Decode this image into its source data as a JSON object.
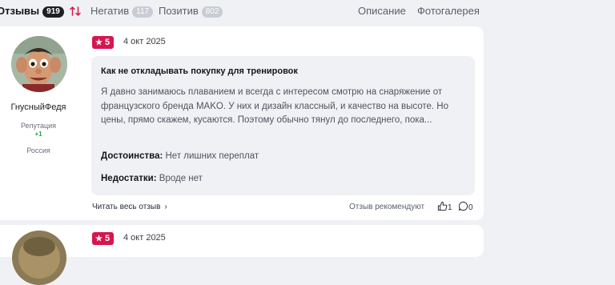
{
  "tabs": {
    "reviews": {
      "label": "Отзывы",
      "count": "919"
    },
    "negative": {
      "label": "Негатив",
      "count": "117"
    },
    "positive": {
      "label": "Позитив",
      "count": "802"
    },
    "description": "Описание",
    "gallery": "Фотогалерея",
    "sort_icon": "sort-arrows-icon"
  },
  "colors": {
    "accent": "#d6164f",
    "page_bg": "#f0f1f4",
    "card_bg": "#ffffff",
    "positive_rep": "#2aa24b"
  },
  "reviews": [
    {
      "user": {
        "name": "ГнусныйФедя",
        "reputation_label": "Репутация",
        "reputation_value": "+1",
        "country": "Россия"
      },
      "rating": "5",
      "date": "4 окт 2025",
      "title": "Как не откладывать покупку для тренировок",
      "text": "Я давно занимаюсь плаванием и всегда с интересом смотрю на снаряжение от французского бренда MAKO. У них и дизайн классный, и качество на высоте. Но цены, прямо скажем, кусаются. Поэтому обычно тянул до последнего, пока...",
      "pros_label": "Достоинства:",
      "pros": "Нет лишних переплат",
      "cons_label": "Недостатки:",
      "cons": "Вроде нет",
      "read_more": "Читать весь отзыв",
      "recommends": "Отзыв рекомендуют",
      "likes": "1",
      "comments": "0"
    },
    {
      "rating": "5",
      "date": "4 окт 2025"
    }
  ]
}
